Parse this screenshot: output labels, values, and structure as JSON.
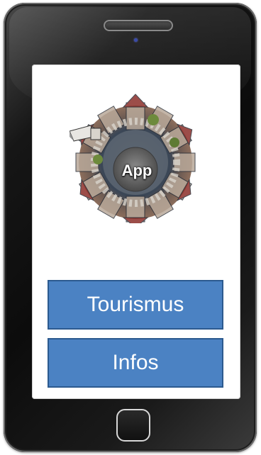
{
  "app": {
    "logo_label": "App"
  },
  "menu": {
    "buttons": [
      {
        "label": "Tourismus"
      },
      {
        "label": "Infos"
      }
    ]
  },
  "colors": {
    "button_fill": "#4b82c3",
    "button_border": "#2c5a8f",
    "phone_body": "#111111",
    "screen": "#ffffff"
  },
  "icons": {
    "logo": "little-planet-town-icon",
    "home": "home-button-icon"
  }
}
